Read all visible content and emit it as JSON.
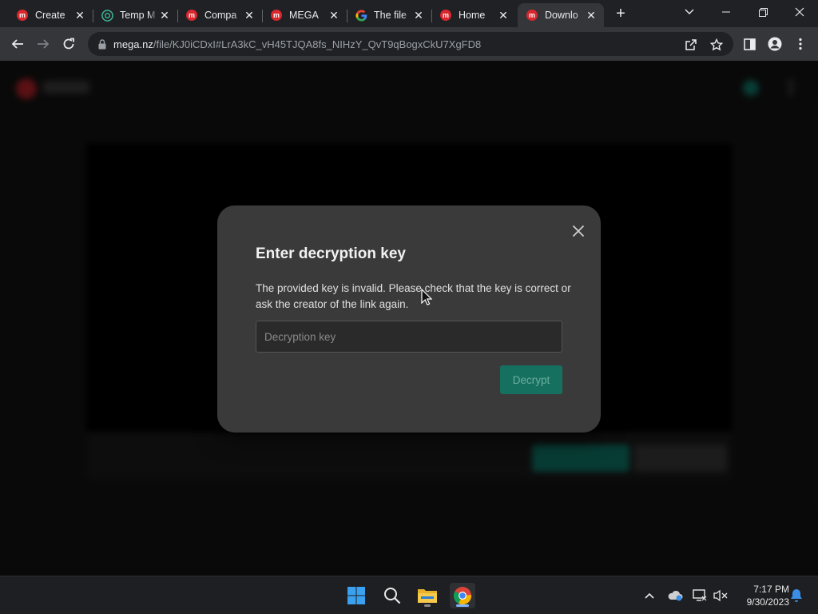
{
  "browser": {
    "tabs": [
      {
        "title": "Create",
        "favicon": "mega-icon",
        "active": false
      },
      {
        "title": "Temp M",
        "favicon": "temp-mail-icon",
        "active": false
      },
      {
        "title": "Compa",
        "favicon": "mega-icon",
        "active": false
      },
      {
        "title": "MEGA",
        "favicon": "mega-icon",
        "active": false
      },
      {
        "title": "The file",
        "favicon": "google-icon",
        "active": false
      },
      {
        "title": "Home",
        "favicon": "mega-icon",
        "active": false
      },
      {
        "title": "Downlo",
        "favicon": "mega-icon",
        "active": true
      }
    ],
    "url_host": "mega.nz",
    "url_path": "/file/KJ0iCDxI#LrA3kC_vH45TJQA8fs_NIHzY_QvT9qBogxCkU7XgFD8"
  },
  "dialog": {
    "title": "Enter decryption key",
    "message": "The provided key is invalid. Please check that the key is correct or ask the creator of the link again.",
    "input_placeholder": "Decryption key",
    "input_value": "",
    "decrypt_label": "Decrypt"
  },
  "taskbar": {
    "time": "7:17 PM",
    "date": "9/30/2023"
  },
  "colors": {
    "mega_red": "#d9272e",
    "accent_teal": "#16705f",
    "dialog_bg": "#3a3a3a"
  }
}
